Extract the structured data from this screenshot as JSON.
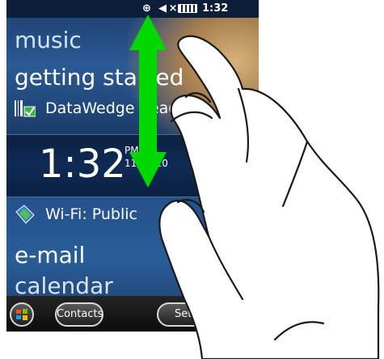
{
  "status_bar": {
    "time": "1:32",
    "icons": [
      "connection-icon",
      "volume-muted-icon",
      "battery-icon"
    ]
  },
  "tiles": {
    "music": "music",
    "getting_started": "getting started",
    "datawedge": "DataWedge Ready",
    "clock_time": "1:32",
    "clock_ampm": "PM",
    "clock_date": "11/29/10",
    "wifi": "Wi-Fi: Public",
    "email": "e-mail",
    "calendar": "calendar"
  },
  "bottom_bar": {
    "contacts": "Contacts",
    "settings": "Settings"
  },
  "overlay": {
    "arrow_color": "#00d800",
    "gesture": "two-way swipe"
  }
}
